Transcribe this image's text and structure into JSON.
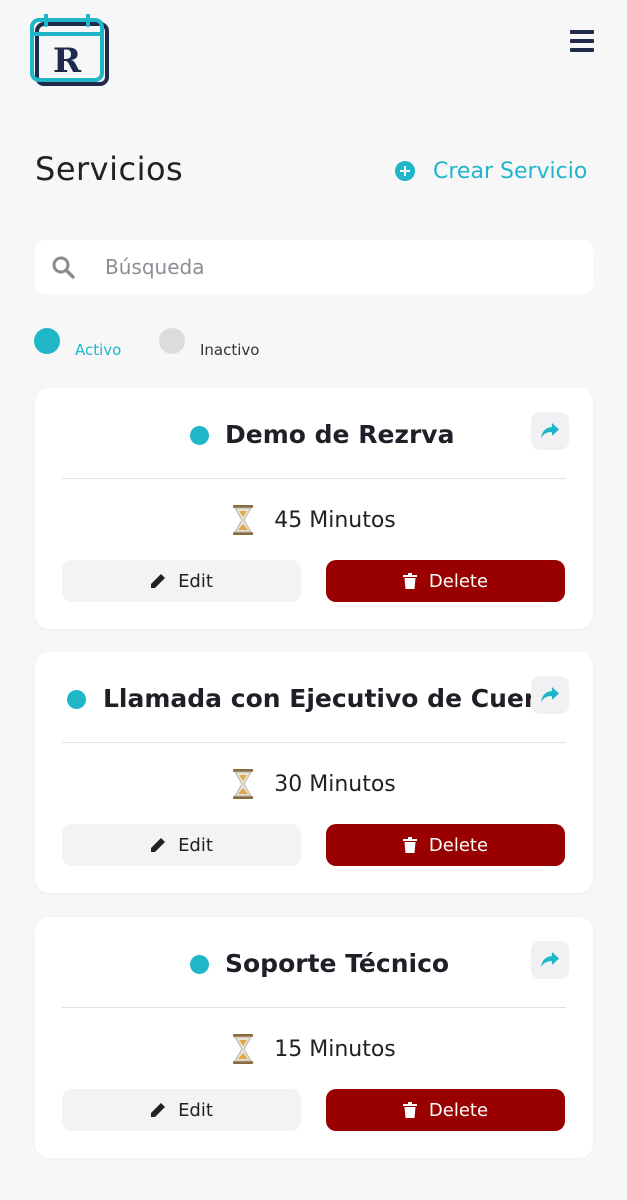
{
  "colors": {
    "accent": "#1fb6c8",
    "inactive": "#dcdcdf",
    "danger": "#990000",
    "navy": "#1f2a4d"
  },
  "header": {
    "logo_letter": "R",
    "menu_icon": "hamburger-icon"
  },
  "page": {
    "title": "Servicios",
    "create_label": "Crear Servicio",
    "create_icon": "plus-circle-icon"
  },
  "search": {
    "placeholder": "Búsqueda",
    "value": "",
    "icon": "search-icon"
  },
  "legend": {
    "active_label": "Activo",
    "inactive_label": "Inactivo"
  },
  "services": [
    {
      "name": "Demo de Rezrva",
      "duration": "45 Minutos",
      "edit_label": "Edit",
      "delete_label": "Delete",
      "status": "active"
    },
    {
      "name": "Llamada con Ejecutivo de Cuenta",
      "duration": "30 Minutos",
      "edit_label": "Edit",
      "delete_label": "Delete",
      "status": "active"
    },
    {
      "name": "Soporte Técnico",
      "duration": "15 Minutos",
      "edit_label": "Edit",
      "delete_label": "Delete",
      "status": "active"
    }
  ]
}
